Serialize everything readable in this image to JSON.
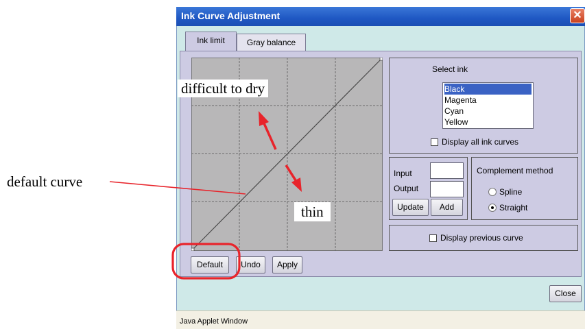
{
  "window": {
    "title": "Ink Curve Adjustment",
    "close_glyph": "✕"
  },
  "tabs": [
    {
      "label": "Ink limit",
      "active": true
    },
    {
      "label": "Gray balance",
      "active": false
    }
  ],
  "select_ink": {
    "label": "Select ink",
    "items": [
      "Black",
      "Magenta",
      "Cyan",
      "Yellow"
    ],
    "selected": "Black",
    "display_all_label": "Display all ink curves",
    "display_all_checked": false
  },
  "io": {
    "input_label": "Input",
    "input_value": "",
    "output_label": "Output",
    "output_value": "",
    "update_label": "Update",
    "add_label": "Add"
  },
  "complement": {
    "label": "Complement method",
    "options": [
      "Spline",
      "Straight"
    ],
    "selected": "Straight"
  },
  "display_previous": {
    "label": "Display previous curve",
    "checked": false
  },
  "buttons": {
    "default": "Default",
    "undo": "Undo",
    "apply": "Apply",
    "close": "Close"
  },
  "status_bar": "Java Applet Window",
  "annotations": {
    "default_curve": "default curve",
    "difficult": "difficult to dry",
    "thin": "thin"
  },
  "colors": {
    "annotation_red": "#e8242b",
    "selection_blue": "#3a62c4",
    "title_blue": "#1f57c3"
  }
}
